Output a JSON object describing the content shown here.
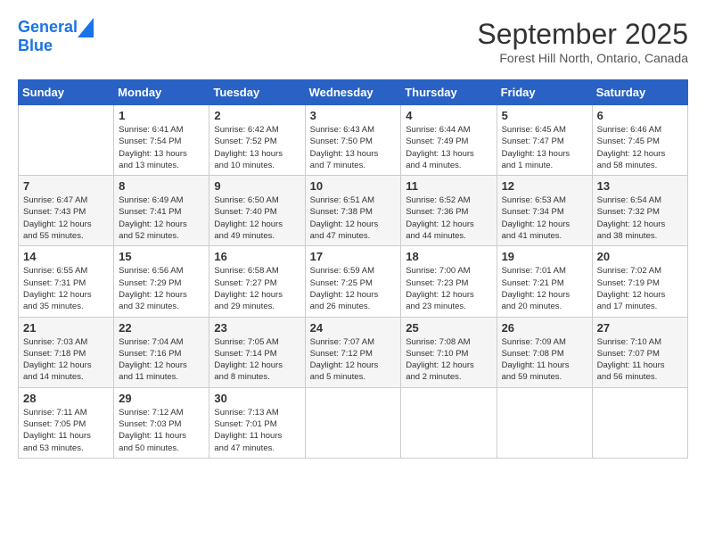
{
  "header": {
    "logo_line1": "General",
    "logo_line2": "Blue",
    "month": "September 2025",
    "location": "Forest Hill North, Ontario, Canada"
  },
  "weekdays": [
    "Sunday",
    "Monday",
    "Tuesday",
    "Wednesday",
    "Thursday",
    "Friday",
    "Saturday"
  ],
  "weeks": [
    [
      {
        "day": "",
        "info": ""
      },
      {
        "day": "1",
        "info": "Sunrise: 6:41 AM\nSunset: 7:54 PM\nDaylight: 13 hours\nand 13 minutes."
      },
      {
        "day": "2",
        "info": "Sunrise: 6:42 AM\nSunset: 7:52 PM\nDaylight: 13 hours\nand 10 minutes."
      },
      {
        "day": "3",
        "info": "Sunrise: 6:43 AM\nSunset: 7:50 PM\nDaylight: 13 hours\nand 7 minutes."
      },
      {
        "day": "4",
        "info": "Sunrise: 6:44 AM\nSunset: 7:49 PM\nDaylight: 13 hours\nand 4 minutes."
      },
      {
        "day": "5",
        "info": "Sunrise: 6:45 AM\nSunset: 7:47 PM\nDaylight: 13 hours\nand 1 minute."
      },
      {
        "day": "6",
        "info": "Sunrise: 6:46 AM\nSunset: 7:45 PM\nDaylight: 12 hours\nand 58 minutes."
      }
    ],
    [
      {
        "day": "7",
        "info": "Sunrise: 6:47 AM\nSunset: 7:43 PM\nDaylight: 12 hours\nand 55 minutes."
      },
      {
        "day": "8",
        "info": "Sunrise: 6:49 AM\nSunset: 7:41 PM\nDaylight: 12 hours\nand 52 minutes."
      },
      {
        "day": "9",
        "info": "Sunrise: 6:50 AM\nSunset: 7:40 PM\nDaylight: 12 hours\nand 49 minutes."
      },
      {
        "day": "10",
        "info": "Sunrise: 6:51 AM\nSunset: 7:38 PM\nDaylight: 12 hours\nand 47 minutes."
      },
      {
        "day": "11",
        "info": "Sunrise: 6:52 AM\nSunset: 7:36 PM\nDaylight: 12 hours\nand 44 minutes."
      },
      {
        "day": "12",
        "info": "Sunrise: 6:53 AM\nSunset: 7:34 PM\nDaylight: 12 hours\nand 41 minutes."
      },
      {
        "day": "13",
        "info": "Sunrise: 6:54 AM\nSunset: 7:32 PM\nDaylight: 12 hours\nand 38 minutes."
      }
    ],
    [
      {
        "day": "14",
        "info": "Sunrise: 6:55 AM\nSunset: 7:31 PM\nDaylight: 12 hours\nand 35 minutes."
      },
      {
        "day": "15",
        "info": "Sunrise: 6:56 AM\nSunset: 7:29 PM\nDaylight: 12 hours\nand 32 minutes."
      },
      {
        "day": "16",
        "info": "Sunrise: 6:58 AM\nSunset: 7:27 PM\nDaylight: 12 hours\nand 29 minutes."
      },
      {
        "day": "17",
        "info": "Sunrise: 6:59 AM\nSunset: 7:25 PM\nDaylight: 12 hours\nand 26 minutes."
      },
      {
        "day": "18",
        "info": "Sunrise: 7:00 AM\nSunset: 7:23 PM\nDaylight: 12 hours\nand 23 minutes."
      },
      {
        "day": "19",
        "info": "Sunrise: 7:01 AM\nSunset: 7:21 PM\nDaylight: 12 hours\nand 20 minutes."
      },
      {
        "day": "20",
        "info": "Sunrise: 7:02 AM\nSunset: 7:19 PM\nDaylight: 12 hours\nand 17 minutes."
      }
    ],
    [
      {
        "day": "21",
        "info": "Sunrise: 7:03 AM\nSunset: 7:18 PM\nDaylight: 12 hours\nand 14 minutes."
      },
      {
        "day": "22",
        "info": "Sunrise: 7:04 AM\nSunset: 7:16 PM\nDaylight: 12 hours\nand 11 minutes."
      },
      {
        "day": "23",
        "info": "Sunrise: 7:05 AM\nSunset: 7:14 PM\nDaylight: 12 hours\nand 8 minutes."
      },
      {
        "day": "24",
        "info": "Sunrise: 7:07 AM\nSunset: 7:12 PM\nDaylight: 12 hours\nand 5 minutes."
      },
      {
        "day": "25",
        "info": "Sunrise: 7:08 AM\nSunset: 7:10 PM\nDaylight: 12 hours\nand 2 minutes."
      },
      {
        "day": "26",
        "info": "Sunrise: 7:09 AM\nSunset: 7:08 PM\nDaylight: 11 hours\nand 59 minutes."
      },
      {
        "day": "27",
        "info": "Sunrise: 7:10 AM\nSunset: 7:07 PM\nDaylight: 11 hours\nand 56 minutes."
      }
    ],
    [
      {
        "day": "28",
        "info": "Sunrise: 7:11 AM\nSunset: 7:05 PM\nDaylight: 11 hours\nand 53 minutes."
      },
      {
        "day": "29",
        "info": "Sunrise: 7:12 AM\nSunset: 7:03 PM\nDaylight: 11 hours\nand 50 minutes."
      },
      {
        "day": "30",
        "info": "Sunrise: 7:13 AM\nSunset: 7:01 PM\nDaylight: 11 hours\nand 47 minutes."
      },
      {
        "day": "",
        "info": ""
      },
      {
        "day": "",
        "info": ""
      },
      {
        "day": "",
        "info": ""
      },
      {
        "day": "",
        "info": ""
      }
    ]
  ]
}
